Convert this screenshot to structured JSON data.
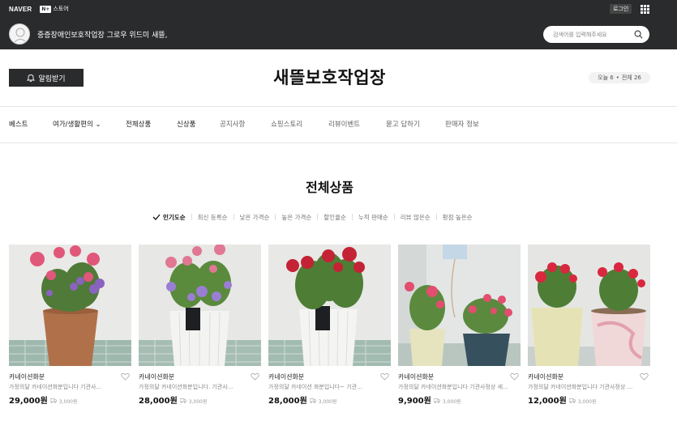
{
  "topbar": {
    "naver_logo": "NAVER",
    "nstore_mark": "N+",
    "nstore_label": "스토어",
    "login_label": "로그인",
    "store_description": "중증장애인보호작업장 그로우 위드미 새뜰,",
    "search_placeholder": "검색어를 입력해주세요"
  },
  "header": {
    "notify_label": "알림받기",
    "store_title": "새뜰보호작업장",
    "visitors_today": "오늘 6",
    "visitors_sep": "•",
    "visitors_total": "전체 26"
  },
  "nav": {
    "items": [
      {
        "label": "베스트"
      },
      {
        "label": "여가/생활편의 ⌄"
      },
      {
        "label": "전체상품"
      },
      {
        "label": "신상품"
      },
      {
        "label": "공지사항"
      },
      {
        "label": "쇼핑스토리"
      },
      {
        "label": "리뷰이벤트"
      },
      {
        "label": "묻고 답하기"
      },
      {
        "label": "판매자 정보"
      }
    ]
  },
  "main": {
    "section_title": "전체상품",
    "sorts": [
      {
        "label": "인기도순"
      },
      {
        "label": "최신 등록순"
      },
      {
        "label": "낮은 가격순"
      },
      {
        "label": "높은 가격순"
      },
      {
        "label": "할인율순"
      },
      {
        "label": "누적 판매순"
      },
      {
        "label": "리뷰 많은순"
      },
      {
        "label": "평점 높은순"
      }
    ],
    "products": [
      {
        "name": "카네이션화분",
        "desc": "가정의달 카네이션화분입니다 기관사...",
        "price": "29,000원",
        "shipping": "3,000원"
      },
      {
        "name": "카네이션화분",
        "desc": "가정의달 카네이션화분입니다. 기관사...",
        "price": "28,000원",
        "shipping": "3,000원"
      },
      {
        "name": "카네이션화분",
        "desc": "가정의달 카네이션 화분입니다~ 기관...",
        "price": "28,000원",
        "shipping": "3,000원"
      },
      {
        "name": "카네이션화분",
        "desc": "가정의달 카네이션화분입니다 기관사정상 세종...",
        "price": "9,900원",
        "shipping": "3,000원"
      },
      {
        "name": "카네이션화분",
        "desc": "가정의달 카네이션화분입니다 기관사정상 ...",
        "price": "12,000원",
        "shipping": "3,000원"
      }
    ]
  },
  "colors": {
    "topbar": "#2a2b2c",
    "accent": "#111111"
  }
}
